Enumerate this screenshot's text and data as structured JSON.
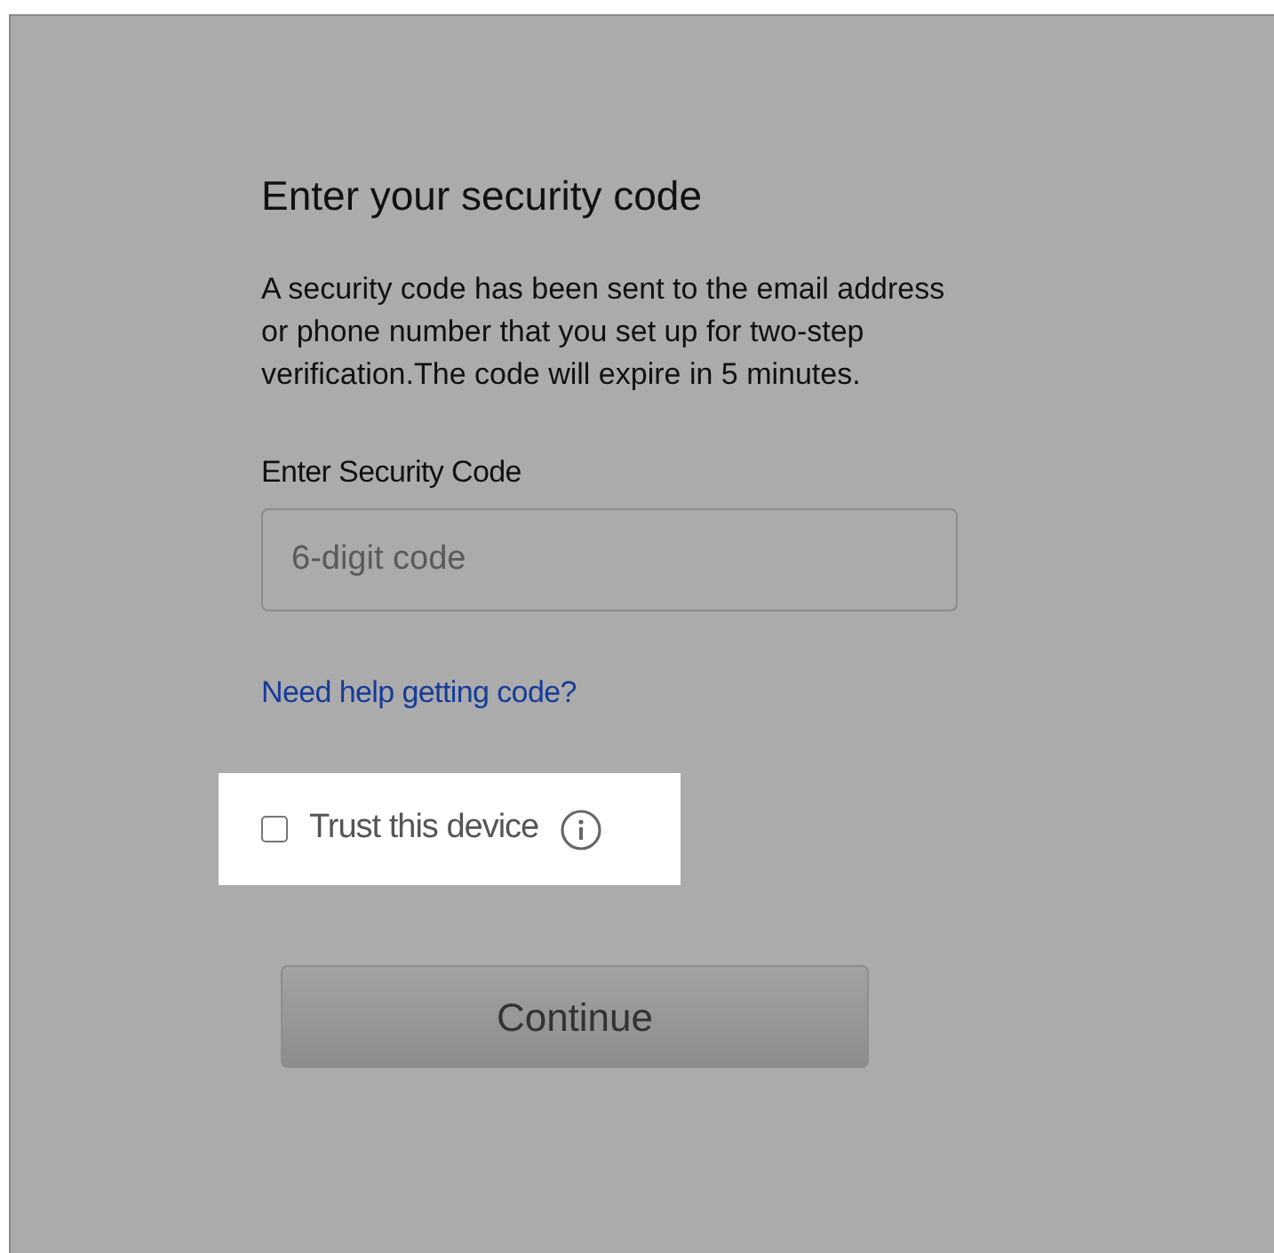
{
  "title": "Enter your security code",
  "description": "A security code has been sent to the email address or phone number that you set up for two-step verification.The code will expire in 5 minutes.",
  "code_field": {
    "label": "Enter Security Code",
    "placeholder": "6-digit code"
  },
  "help_link": "Need help getting code?",
  "trust_device": {
    "label": "Trust this device",
    "checked": false,
    "highlighted": true
  },
  "buttons": [
    {
      "label": "Continue"
    }
  ]
}
